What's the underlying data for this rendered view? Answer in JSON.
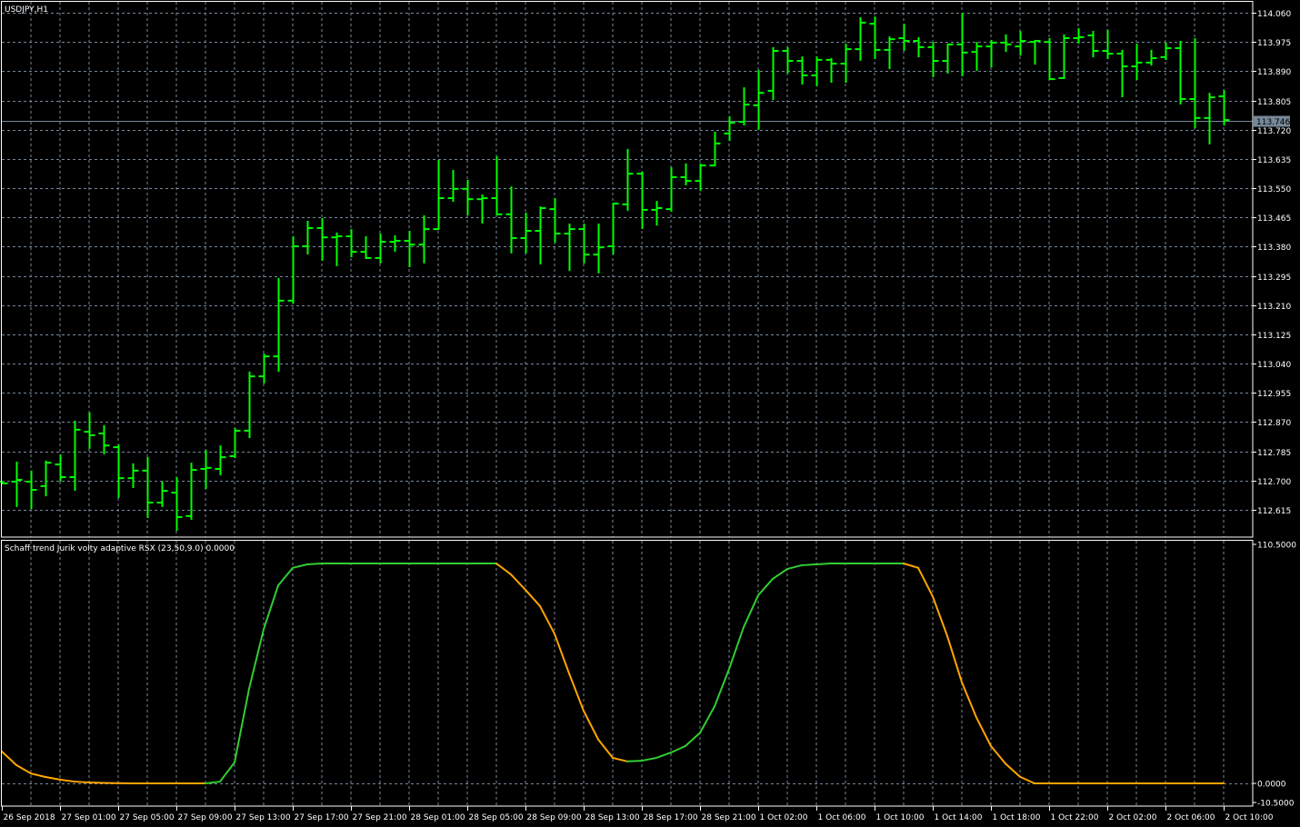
{
  "chart_data": [
    {
      "type": "ohlc",
      "title": "USDJPY,H1",
      "symbol": "USDJPY",
      "timeframe": "H1",
      "current_price": "113.746",
      "ylim": [
        112.58,
        114.08
      ],
      "yticks": [
        "114.060",
        "113.975",
        "113.890",
        "113.805",
        "113.720",
        "113.635",
        "113.550",
        "113.465",
        "113.380",
        "113.295",
        "113.210",
        "113.125",
        "113.040",
        "112.955",
        "112.870",
        "112.785",
        "112.700",
        "112.615"
      ],
      "grid": true,
      "bars": [
        [
          112.697,
          112.697,
          112.692,
          112.692
        ],
        [
          112.697,
          112.755,
          112.626,
          112.702
        ],
        [
          112.697,
          112.729,
          112.62,
          112.673
        ],
        [
          112.684,
          112.758,
          112.657,
          112.752
        ],
        [
          112.747,
          112.776,
          112.7,
          112.71
        ],
        [
          112.71,
          112.874,
          112.673,
          112.848
        ],
        [
          112.842,
          112.898,
          112.795,
          112.832
        ],
        [
          112.837,
          112.861,
          112.779,
          112.802
        ],
        [
          112.797,
          112.805,
          112.652,
          112.707
        ],
        [
          112.707,
          112.75,
          112.681,
          112.729
        ],
        [
          112.729,
          112.768,
          112.594,
          112.636
        ],
        [
          112.636,
          112.697,
          112.626,
          112.67
        ],
        [
          112.665,
          112.71,
          112.557,
          112.594
        ],
        [
          112.597,
          112.752,
          112.589,
          112.731
        ],
        [
          112.734,
          112.789,
          112.678,
          112.737
        ],
        [
          112.734,
          112.802,
          112.718,
          112.768
        ],
        [
          112.771,
          112.853,
          112.768,
          112.845
        ],
        [
          112.845,
          113.017,
          112.826,
          113.003
        ],
        [
          113.003,
          113.069,
          112.985,
          113.061
        ],
        [
          113.061,
          113.289,
          113.019,
          113.223
        ],
        [
          113.223,
          113.41,
          113.217,
          113.381
        ],
        [
          113.381,
          113.455,
          113.36,
          113.434
        ],
        [
          113.434,
          113.463,
          113.342,
          113.407
        ],
        [
          113.407,
          113.421,
          113.326,
          113.41
        ],
        [
          113.41,
          113.431,
          113.352,
          113.365
        ],
        [
          113.365,
          113.41,
          113.347,
          113.347
        ],
        [
          113.347,
          113.418,
          113.334,
          113.394
        ],
        [
          113.394,
          113.413,
          113.368,
          113.397
        ],
        [
          113.397,
          113.426,
          113.323,
          113.386
        ],
        [
          113.386,
          113.471,
          113.334,
          113.431
        ],
        [
          113.431,
          113.632,
          113.431,
          113.521
        ],
        [
          113.521,
          113.603,
          113.513,
          113.548
        ],
        [
          113.548,
          113.574,
          113.474,
          113.518
        ],
        [
          113.518,
          113.532,
          113.45,
          113.521
        ],
        [
          113.521,
          113.643,
          113.474,
          113.474
        ],
        [
          113.474,
          113.555,
          113.363,
          113.405
        ],
        [
          113.405,
          113.479,
          113.363,
          113.426
        ],
        [
          113.426,
          113.497,
          113.331,
          113.492
        ],
        [
          113.489,
          113.521,
          113.394,
          113.418
        ],
        [
          113.418,
          113.447,
          113.312,
          113.431
        ],
        [
          113.431,
          113.447,
          113.334,
          113.357
        ],
        [
          113.357,
          113.447,
          113.305,
          113.378
        ],
        [
          113.381,
          113.508,
          113.36,
          113.505
        ],
        [
          113.503,
          113.664,
          113.487,
          113.592
        ],
        [
          113.592,
          113.598,
          113.434,
          113.487
        ],
        [
          113.487,
          113.513,
          113.444,
          113.492
        ],
        [
          113.489,
          113.611,
          113.484,
          113.582
        ],
        [
          113.582,
          113.622,
          113.561,
          113.571
        ],
        [
          113.571,
          113.622,
          113.545,
          113.616
        ],
        [
          113.616,
          113.714,
          113.616,
          113.68
        ],
        [
          113.709,
          113.759,
          113.69,
          113.74
        ],
        [
          113.743,
          113.843,
          113.735,
          113.793
        ],
        [
          113.791,
          113.894,
          113.722,
          113.827
        ],
        [
          113.833,
          113.96,
          113.809,
          113.949
        ],
        [
          113.949,
          113.96,
          113.886,
          113.92
        ],
        [
          113.92,
          113.933,
          113.854,
          113.878
        ],
        [
          113.878,
          113.933,
          113.849,
          113.923
        ],
        [
          113.923,
          113.928,
          113.859,
          113.912
        ],
        [
          113.912,
          113.97,
          113.859,
          113.954
        ],
        [
          113.954,
          114.047,
          113.923,
          114.031
        ],
        [
          114.028,
          114.049,
          113.928,
          113.952
        ],
        [
          113.952,
          113.991,
          113.899,
          113.983
        ],
        [
          113.986,
          114.028,
          113.952,
          113.978
        ],
        [
          113.978,
          113.989,
          113.933,
          113.96
        ],
        [
          113.96,
          113.975,
          113.875,
          113.92
        ],
        [
          113.92,
          113.97,
          113.886,
          113.968
        ],
        [
          113.968,
          114.06,
          113.878,
          113.944
        ],
        [
          113.946,
          113.975,
          113.894,
          113.962
        ],
        [
          113.962,
          113.981,
          113.904,
          113.973
        ],
        [
          113.973,
          113.997,
          113.949,
          113.968
        ],
        [
          113.962,
          114.007,
          113.938,
          113.978
        ],
        [
          113.975,
          113.981,
          113.912,
          113.978
        ],
        [
          113.975,
          113.986,
          113.867,
          113.867
        ],
        [
          113.87,
          113.997,
          113.87,
          113.986
        ],
        [
          113.986,
          114.015,
          113.973,
          113.989
        ],
        [
          113.994,
          114.007,
          113.933,
          113.949
        ],
        [
          113.949,
          114.01,
          113.928,
          113.941
        ],
        [
          113.941,
          113.952,
          113.817,
          113.904
        ],
        [
          113.904,
          113.97,
          113.867,
          113.915
        ],
        [
          113.915,
          113.952,
          113.909,
          113.928
        ],
        [
          113.931,
          113.973,
          113.925,
          113.957
        ],
        [
          113.957,
          113.978,
          113.796,
          113.809
        ],
        [
          113.809,
          113.986,
          113.727,
          113.754
        ],
        [
          113.754,
          113.827,
          113.68,
          113.814
        ],
        [
          113.817,
          113.835,
          113.735,
          113.748
        ]
      ],
      "colors": {
        "bar": "#00ff00",
        "grid": "#778899",
        "price_line": "#778899",
        "border": "#ffffff",
        "text": "#ffffff"
      }
    },
    {
      "type": "line",
      "title": "Schaff trend Jurik volty adaptive RSX (23,50,9.0) 0.0000",
      "ylim": [
        -10.5,
        110.5
      ],
      "yticks": [
        "110.5000",
        "0.0000",
        "-10.5000"
      ],
      "values": [
        14.5,
        8.3,
        4.5,
        2.9,
        1.7,
        0.8,
        0.4,
        0.2,
        0.1,
        0,
        0,
        0,
        0,
        0,
        0,
        0.8,
        9.5,
        43,
        70,
        90,
        98,
        99.6,
        100,
        100,
        100,
        100,
        100,
        100,
        100,
        100,
        100,
        100,
        100,
        100,
        100,
        95,
        88,
        80.6,
        68,
        50,
        33,
        20,
        11.6,
        10,
        10.3,
        11.6,
        14,
        17,
        23,
        35,
        52,
        71,
        85.5,
        93,
        97.5,
        99.2,
        99.6,
        100,
        100,
        100,
        100,
        100,
        100,
        98,
        85,
        67,
        46,
        30,
        17,
        9,
        3,
        0,
        0,
        0,
        0,
        0,
        0,
        0,
        0,
        0,
        0,
        0,
        0,
        0,
        0
      ],
      "colors": {
        "up": "#32cd32",
        "down": "#ffa500"
      }
    }
  ],
  "time_axis": [
    {
      "bar": 0,
      "label": "26 Sep 2018"
    },
    {
      "bar": 4,
      "label": "27 Sep 01:00"
    },
    {
      "bar": 8,
      "label": "27 Sep 05:00"
    },
    {
      "bar": 12,
      "label": "27 Sep 09:00"
    },
    {
      "bar": 16,
      "label": "27 Sep 13:00"
    },
    {
      "bar": 20,
      "label": "27 Sep 17:00"
    },
    {
      "bar": 24,
      "label": "27 Sep 21:00"
    },
    {
      "bar": 28,
      "label": "28 Sep 01:00"
    },
    {
      "bar": 32,
      "label": "28 Sep 05:00"
    },
    {
      "bar": 36,
      "label": "28 Sep 09:00"
    },
    {
      "bar": 40,
      "label": "28 Sep 13:00"
    },
    {
      "bar": 44,
      "label": "28 Sep 17:00"
    },
    {
      "bar": 48,
      "label": "28 Sep 21:00"
    },
    {
      "bar": 52,
      "label": "1 Oct 02:00"
    },
    {
      "bar": 56,
      "label": "1 Oct 06:00"
    },
    {
      "bar": 60,
      "label": "1 Oct 10:00"
    },
    {
      "bar": 64,
      "label": "1 Oct 14:00"
    },
    {
      "bar": 68,
      "label": "1 Oct 18:00"
    },
    {
      "bar": 72,
      "label": "1 Oct 22:00"
    },
    {
      "bar": 76,
      "label": "2 Oct 02:00"
    },
    {
      "bar": 80,
      "label": "2 Oct 06:00"
    },
    {
      "bar": 84,
      "label": "2 Oct 10:00"
    }
  ]
}
